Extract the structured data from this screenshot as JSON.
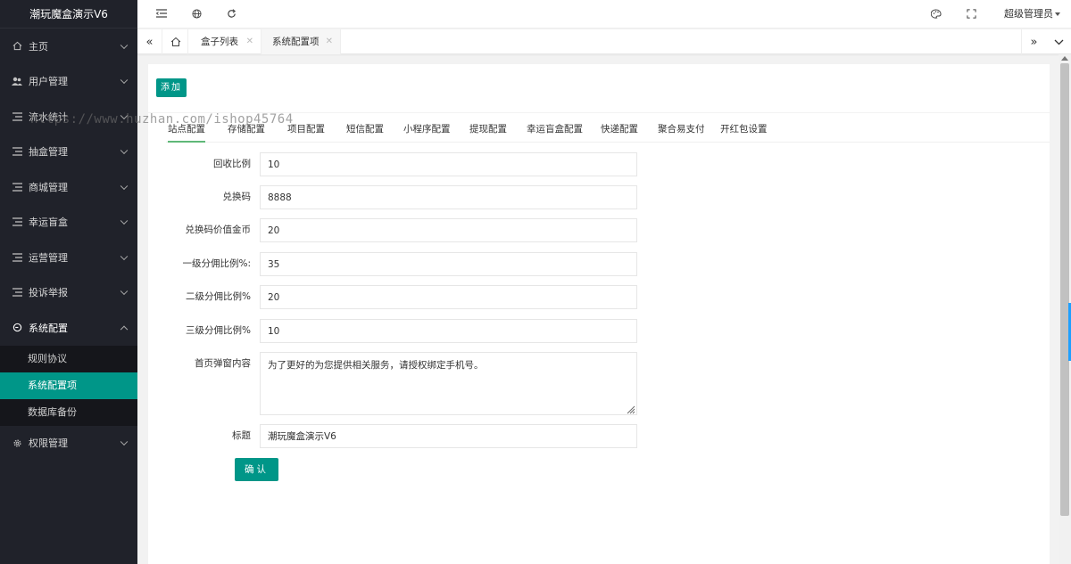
{
  "app": {
    "title": "潮玩魔盒演示V6"
  },
  "sidebar": {
    "items": [
      {
        "label": "主页",
        "icon": "home-icon"
      },
      {
        "label": "用户管理",
        "icon": "users-icon"
      },
      {
        "label": "流水统计",
        "icon": "list-icon"
      },
      {
        "label": "抽盒管理",
        "icon": "list-icon"
      },
      {
        "label": "商城管理",
        "icon": "list-icon"
      },
      {
        "label": "幸运盲盒",
        "icon": "list-icon"
      },
      {
        "label": "运营管理",
        "icon": "list-icon"
      },
      {
        "label": "投诉举报",
        "icon": "list-icon"
      },
      {
        "label": "系统配置",
        "icon": "settings-icon"
      },
      {
        "label": "权限管理",
        "icon": "gear-icon"
      }
    ],
    "submenu": [
      {
        "label": "规则协议"
      },
      {
        "label": "系统配置项"
      },
      {
        "label": "数据库备份"
      }
    ]
  },
  "header": {
    "user": "超级管理员",
    "icons": [
      "menu-toggle-icon",
      "globe-icon",
      "refresh-icon",
      "palette-icon",
      "fullscreen-icon"
    ]
  },
  "tabsbar": {
    "tabs": [
      {
        "label": "盒子列表"
      },
      {
        "label": "系统配置项"
      }
    ]
  },
  "toolbar": {
    "add_label": "添加"
  },
  "config_tabs": [
    {
      "label": "站点配置"
    },
    {
      "label": "存储配置"
    },
    {
      "label": "项目配置"
    },
    {
      "label": "短信配置"
    },
    {
      "label": "小程序配置"
    },
    {
      "label": "提现配置"
    },
    {
      "label": "幸运盲盒配置"
    },
    {
      "label": "快递配置"
    },
    {
      "label": "聚合易支付"
    },
    {
      "label": "开红包设置"
    }
  ],
  "form": {
    "recycle_ratio": {
      "label": "回收比例",
      "value": "10"
    },
    "redeem_code": {
      "label": "兑换码",
      "value": "8888"
    },
    "redeem_value": {
      "label": "兑换码价值金币",
      "value": "20"
    },
    "level1": {
      "label": "一级分佣比例%:",
      "value": "35"
    },
    "level2": {
      "label": "二级分佣比例%",
      "value": "20"
    },
    "level3": {
      "label": "三级分佣比例%",
      "value": "10"
    },
    "popup": {
      "label": "首页弹窗内容",
      "value": "为了更好的为您提供相关服务，请授权绑定手机号。"
    },
    "title": {
      "label": "标题",
      "value": "潮玩魔盒演示V6"
    },
    "confirm_label": "确认"
  },
  "watermark": "https://www.huzhan.com/ishop45764"
}
